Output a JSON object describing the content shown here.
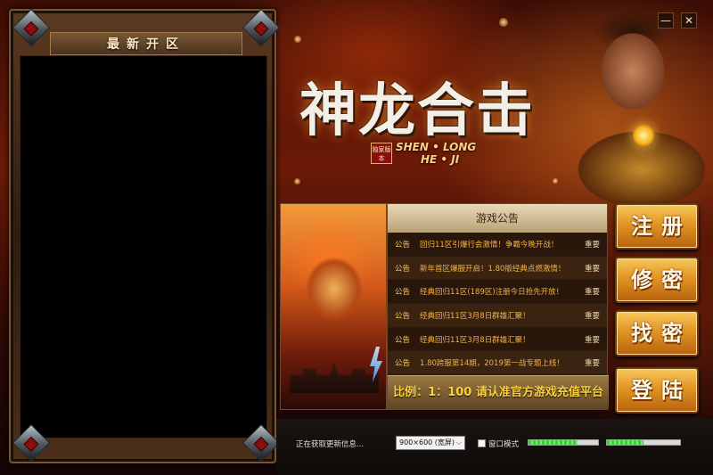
{
  "window": {
    "minimize_label": "—",
    "close_label": "✕"
  },
  "server_list": {
    "header": "最新开区"
  },
  "logo": {
    "title": "神龙合击",
    "badge": "独家版本",
    "subtitle_line1": "SHEN • LONG",
    "subtitle_line2": "HE • JI"
  },
  "announcements": {
    "title": "游戏公告",
    "items": [
      {
        "tag": "公告",
        "text": "回归11区引爆行会激情！争霸今晚开战！",
        "importance": "重要"
      },
      {
        "tag": "公告",
        "text": "新年首区爆服开启！1.80版经典点燃激情！",
        "importance": "重要"
      },
      {
        "tag": "公告",
        "text": "经典回归11区(189区)注册今日抢先开放！",
        "importance": "重要"
      },
      {
        "tag": "公告",
        "text": "经典回归11区3月8日群雄汇聚！",
        "importance": "重要"
      },
      {
        "tag": "公告",
        "text": "经典回归11区3月8日群雄汇聚！",
        "importance": "重要"
      },
      {
        "tag": "公告",
        "text": "1.80跨服第14期，2019第一战专题上线！",
        "importance": "重要"
      }
    ],
    "ratio": "比例：1：100 请认准官方游戏充值平台"
  },
  "actions": {
    "register": "注册",
    "change_password": "修密",
    "recover_password": "找密",
    "login": "登陆"
  },
  "footer": {
    "status": "正在获取更新信息...",
    "resolution": "900×600 (宽屏)",
    "windowed_mode_label": "窗口模式",
    "windowed_mode_checked": false,
    "progress_1": 0.7,
    "progress_2": 0.5
  },
  "colors": {
    "accent_gold": "#e29524",
    "notice_text": "#f0b14a",
    "ratio_text": "#ffd23a"
  }
}
